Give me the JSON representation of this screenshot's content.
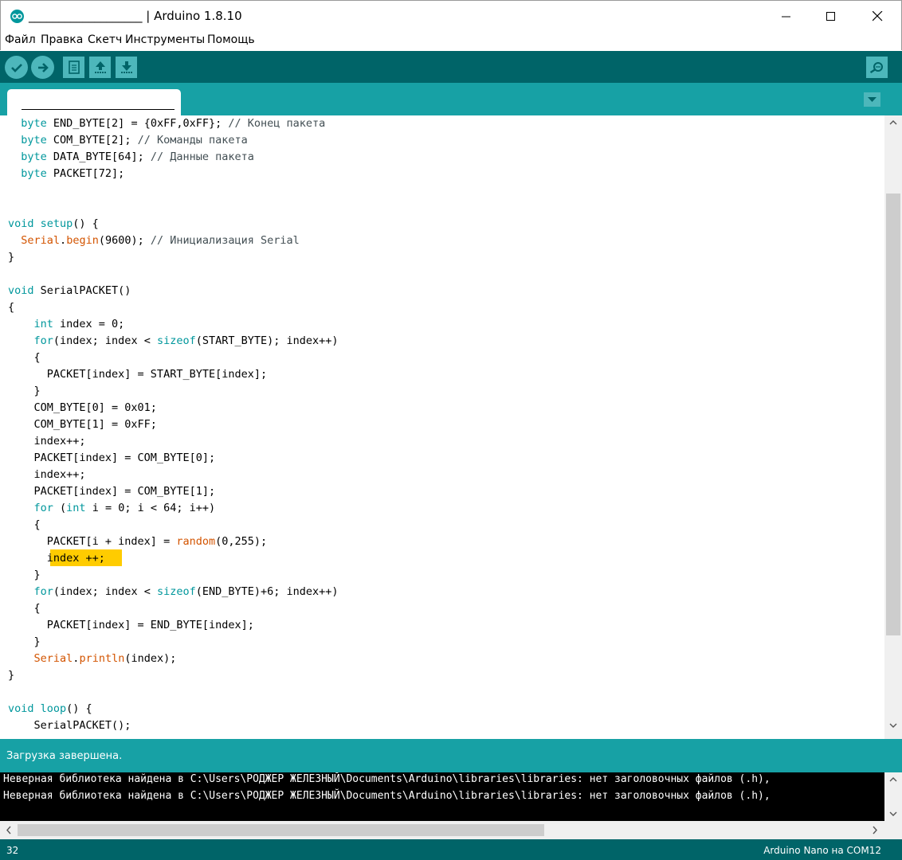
{
  "window": {
    "title": "___________________ | Arduino 1.8.10"
  },
  "menu": {
    "items": [
      {
        "label": "Файл"
      },
      {
        "label": "Правка"
      },
      {
        "label": "Скетч"
      },
      {
        "label": "Инструменты"
      },
      {
        "label": "Помощь"
      }
    ]
  },
  "toolbar": {
    "verify_icon": "check-icon",
    "upload_icon": "arrow-right-icon",
    "new_icon": "file-icon",
    "open_icon": "arrow-up-icon",
    "save_icon": "arrow-down-icon",
    "serial_monitor_icon": "magnifier-icon"
  },
  "editor": {
    "lines": [
      "  byte END_BYTE[2] = {0xFF,0xFF}; // Конец пакета",
      "  byte COM_BYTE[2]; // Команды пакета",
      "  byte DATA_BYTE[64]; // Данные пакета",
      "  byte PACKET[72];",
      "",
      "",
      "void setup() {",
      "  Serial.begin(9600); // Инициализация Serial",
      "}",
      "",
      "void SerialPACKET()",
      "{",
      "    int index = 0;",
      "    for(index; index < sizeof(START_BYTE); index++)",
      "    {",
      "      PACKET[index] = START_BYTE[index];",
      "    }",
      "    COM_BYTE[0] = 0x01;",
      "    COM_BYTE[1] = 0xFF;",
      "    index++;",
      "    PACKET[index] = COM_BYTE[0];",
      "    index++;",
      "    PACKET[index] = COM_BYTE[1];",
      "    for (int i = 0; i < 64; i++)",
      "    {",
      "      PACKET[i + index] = random(0,255);",
      "      index ++;",
      "    }",
      "    for(index; index < sizeof(END_BYTE)+6; index++)",
      "    {",
      "      PACKET[index] = END_BYTE[index];",
      "    }",
      "    Serial.println(index);",
      "}",
      "",
      "void loop() {",
      "    SerialPACKET();"
    ]
  },
  "status": {
    "message": "Загрузка завершена."
  },
  "console": {
    "lines": [
      "Неверная библиотека найдена в C:\\Users\\РОДЖЕР ЖЕЛЕЗНЫЙ\\Documents\\Arduino\\libraries\\libraries: нет заголовочных файлов (.h),",
      "Неверная библиотека найдена в C:\\Users\\РОДЖЕР ЖЕЛЕЗНЫЙ\\Documents\\Arduino\\libraries\\libraries: нет заголовочных файлов (.h),"
    ]
  },
  "footer": {
    "line_number": "32",
    "board": "Arduino Nano на COM12"
  },
  "colors": {
    "toolbar": "#006468",
    "tab_bar": "#17a1a5",
    "button": "#4db7bb",
    "keyword": "#00979c",
    "function": "#d35400",
    "highlight": "#ffcc00"
  }
}
